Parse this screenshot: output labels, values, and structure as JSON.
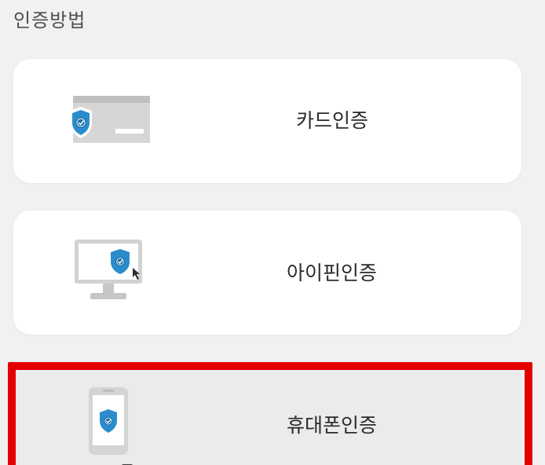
{
  "section": {
    "title": "인증방법"
  },
  "methods": [
    {
      "label": "카드인증",
      "icon": "credit-card-shield-icon",
      "selected": false
    },
    {
      "label": "아이핀인증",
      "icon": "monitor-shield-cursor-icon",
      "selected": false
    },
    {
      "label": "휴대폰인증",
      "icon": "phone-shield-icon",
      "selected": true
    }
  ],
  "colors": {
    "background": "#f1f1f1",
    "card": "#ffffff",
    "shield": "#2a8ccc",
    "icon_gray": "#cfcfcf",
    "highlight": "#e30000"
  }
}
